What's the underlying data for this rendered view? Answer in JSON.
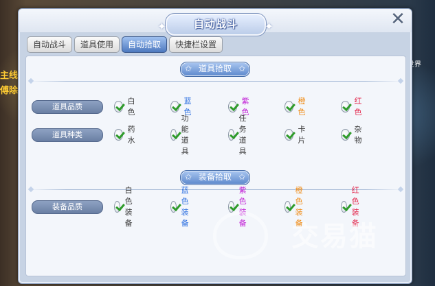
{
  "dialog": {
    "title": "自动战斗",
    "close_icon": "close-icon"
  },
  "tabs": [
    {
      "label": "自动战斗",
      "active": false
    },
    {
      "label": "道具使用",
      "active": false
    },
    {
      "label": "自动拾取",
      "active": true
    },
    {
      "label": "快捷栏设置",
      "active": false
    }
  ],
  "item_section": {
    "title": "道具拾取",
    "quality_row": {
      "label": "道具品质",
      "options": [
        {
          "label": "白色",
          "checked": true,
          "color": "#3b3b3b"
        },
        {
          "label": "蓝色",
          "checked": true,
          "color": "#2c6fe0"
        },
        {
          "label": "紫色",
          "checked": true,
          "color": "#c11fd6"
        },
        {
          "label": "橙色",
          "checked": true,
          "color": "#f08a12"
        },
        {
          "label": "红色",
          "checked": true,
          "color": "#e3264b"
        }
      ]
    },
    "type_row": {
      "label": "道具种类",
      "options": [
        {
          "label": "药水",
          "checked": true
        },
        {
          "label": "功能道具",
          "checked": true
        },
        {
          "label": "任务道具",
          "checked": true
        },
        {
          "label": "卡片",
          "checked": true
        },
        {
          "label": "杂物",
          "checked": true
        }
      ]
    }
  },
  "equip_section": {
    "title": "装备拾取",
    "quality_row": {
      "label": "装备品质",
      "options": [
        {
          "label": "白色装备",
          "checked": true,
          "color": "#3b3b3b"
        },
        {
          "label": "蓝色装备",
          "checked": true,
          "color": "#2c6fe0"
        },
        {
          "label": "紫色装备",
          "checked": true,
          "color": "#c11fd6"
        },
        {
          "label": "橙色装备",
          "checked": true,
          "color": "#f08a12"
        },
        {
          "label": "红色装备",
          "checked": true,
          "color": "#e3264b"
        }
      ]
    }
  },
  "background": {
    "left_text": [
      "主线",
      "傅除"
    ],
    "right_label": "世界",
    "watermark": "交易猫"
  }
}
